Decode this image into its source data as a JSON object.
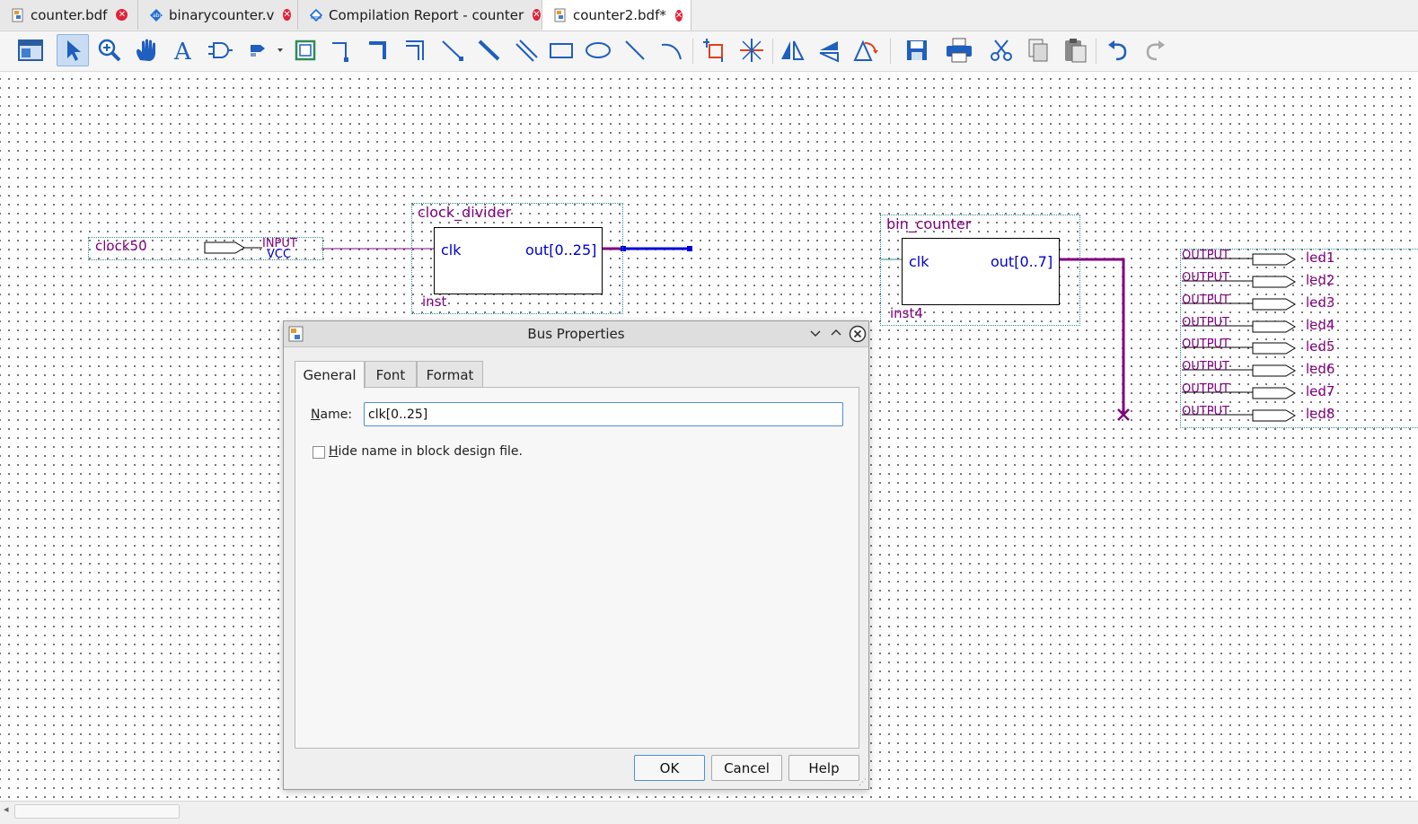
{
  "tabs": [
    {
      "label": "counter.bdf",
      "icon": "bdf-file-icon",
      "active": false
    },
    {
      "label": "binarycounter.v",
      "icon": "verilog-file-icon",
      "active": false
    },
    {
      "label": "Compilation Report - counter",
      "icon": "report-icon",
      "active": false
    },
    {
      "label": "counter2.bdf*",
      "icon": "bdf-file-icon",
      "active": true
    }
  ],
  "toolbar": {
    "icons": [
      "detach-window-icon",
      "selection-tool-icon",
      "zoom-tool-icon",
      "hand-tool-icon",
      "text-tool-icon",
      "symbol-tool-icon",
      "pin-tool-icon",
      "block-tool-icon",
      "orthogonal-node-icon",
      "orthogonal-bus-icon",
      "orthogonal-conduit-icon",
      "diagonal-node-icon",
      "diagonal-bus-icon",
      "diagonal-conduit-icon",
      "rectangle-tool-icon",
      "oval-tool-icon",
      "line-tool-icon",
      "arc-tool-icon",
      "rubberbanding-icon",
      "partial-line-select-icon",
      "flip-horizontal-icon",
      "flip-vertical-icon",
      "rotate-icon",
      "save-icon",
      "print-icon",
      "cut-icon",
      "copy-icon",
      "paste-icon",
      "undo-icon",
      "redo-icon"
    ]
  },
  "schematic": {
    "input_pin": {
      "name": "clock50",
      "type": "INPUT",
      "default": "VCC"
    },
    "block1": {
      "title": "clock_divider",
      "port_in": "clk",
      "port_out": "out[0..25]",
      "instance": "inst"
    },
    "block2": {
      "title": "bin_counter",
      "port_in": "clk",
      "port_out": "out[0..7]",
      "instance": "inst4"
    },
    "output_type": "OUTPUT",
    "outputs": [
      "led1",
      "led2",
      "led3",
      "led4",
      "led5",
      "led6",
      "led7",
      "led8"
    ]
  },
  "dialog": {
    "title": "Bus Properties",
    "tabs": [
      "General",
      "Font",
      "Format"
    ],
    "active_tab": "General",
    "name_label_first": "N",
    "name_label_rest": "ame:",
    "name_value": "clk[0..25]",
    "hide_first": "H",
    "hide_rest": "ide name in block design file.",
    "hide_checked": false,
    "buttons": {
      "ok": "OK",
      "cancel": "Cancel",
      "help": "Help"
    }
  }
}
